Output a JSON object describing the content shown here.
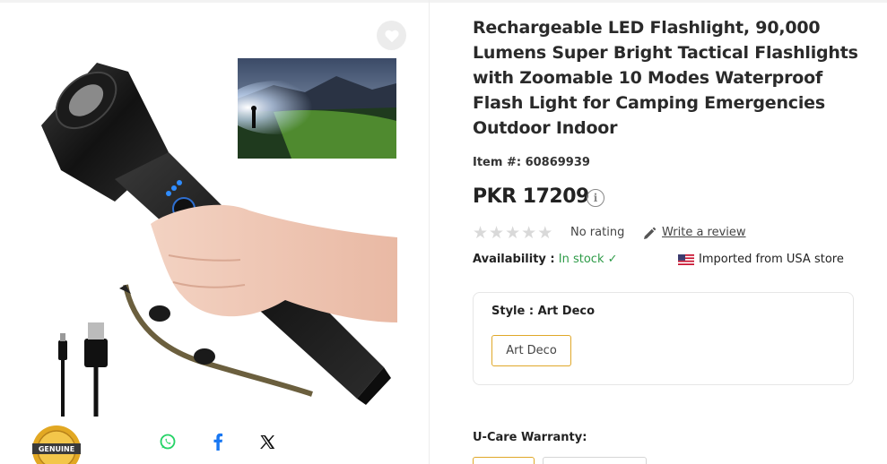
{
  "product": {
    "title": "Rechargeable LED Flashlight, 90,000 Lumens Super Bright Tactical Flashlights with Zoomable 10 Modes Waterproof Flash Light for Camping Emergencies Outdoor Indoor",
    "item_label": "Item #:",
    "item_number": "60869939",
    "price": "PKR 17209",
    "rating_text": "No rating",
    "rating_stars": 0,
    "rating_max": 5,
    "write_review": "Write a review",
    "availability_label": "Availability :",
    "availability_value": "In stock",
    "imported_text": "Imported from USA store"
  },
  "style": {
    "label": "Style : Art Deco",
    "selected_option": "Art Deco"
  },
  "warranty": {
    "label": "U-Care Warranty:"
  },
  "badge": {
    "text": "GENUINE"
  },
  "icons": {
    "wishlist": "heart-icon",
    "whatsapp": "whatsapp-icon",
    "facebook": "facebook-icon",
    "x": "x-icon",
    "info": "info-icon",
    "pencil": "pencil-icon",
    "flag": "us-flag-icon"
  },
  "colors": {
    "accent": "#e0a829",
    "in_stock": "#2e9b48",
    "whatsapp": "#25d366",
    "facebook": "#1877f2"
  }
}
